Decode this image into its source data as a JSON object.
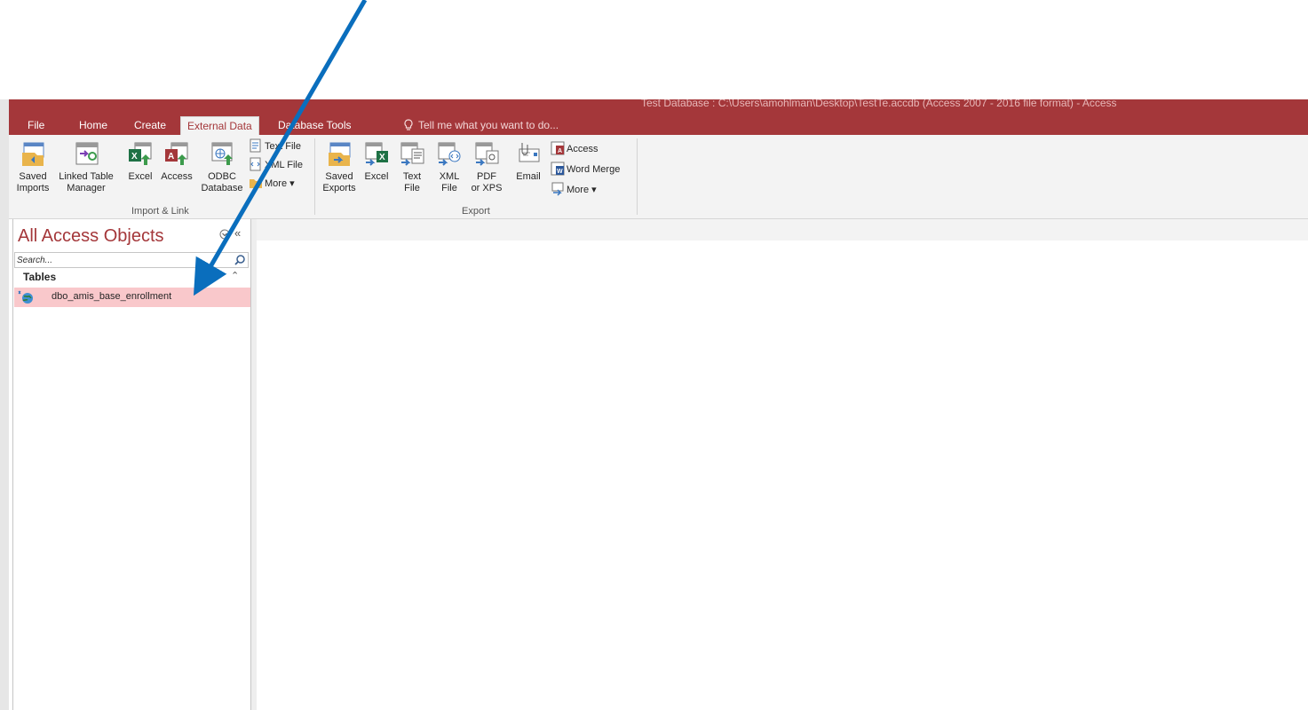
{
  "window": {
    "title": "Test Database : C:\\Users\\amohlman\\Desktop\\TestTe.accdb (Access 2007 - 2016 file format) - Access"
  },
  "tabs": [
    {
      "label": "File"
    },
    {
      "label": "Home"
    },
    {
      "label": "Create"
    },
    {
      "label": "External Data"
    },
    {
      "label": "Database Tools"
    }
  ],
  "active_tab": "External Data",
  "tell_me": {
    "placeholder": "Tell me what you want to do..."
  },
  "ribbon": {
    "import_link": {
      "label": "Import & Link",
      "saved_imports": {
        "line1": "Saved",
        "line2": "Imports"
      },
      "linked_table_manager": {
        "line1": "Linked Table",
        "line2": "Manager"
      },
      "excel": {
        "line1": "Excel"
      },
      "access": {
        "line1": "Access"
      },
      "odbc": {
        "line1": "ODBC",
        "line2": "Database"
      },
      "text_file": "Text File",
      "xml_file": "XML File",
      "more": "More"
    },
    "export": {
      "label": "Export",
      "saved_exports": {
        "line1": "Saved",
        "line2": "Exports"
      },
      "excel": {
        "line1": "Excel"
      },
      "text_file": {
        "line1": "Text",
        "line2": "File"
      },
      "xml_file": {
        "line1": "XML",
        "line2": "File"
      },
      "pdf_xps": {
        "line1": "PDF",
        "line2": "or XPS"
      },
      "email": {
        "line1": "Email"
      },
      "access": "Access",
      "word_merge": "Word Merge",
      "more": "More"
    }
  },
  "nav_pane": {
    "title": "All Access Objects",
    "collapse_glyph": "«",
    "search": {
      "placeholder": "Search..."
    },
    "group": {
      "label": "Tables",
      "chevron": "⌃"
    },
    "items": [
      {
        "label": "dbo_amis_base_enrollment",
        "selected": true
      }
    ]
  },
  "colors": {
    "accent": "#a4373a",
    "selected_item": "#f9c8cb",
    "arrow": "#0a6ebd"
  }
}
